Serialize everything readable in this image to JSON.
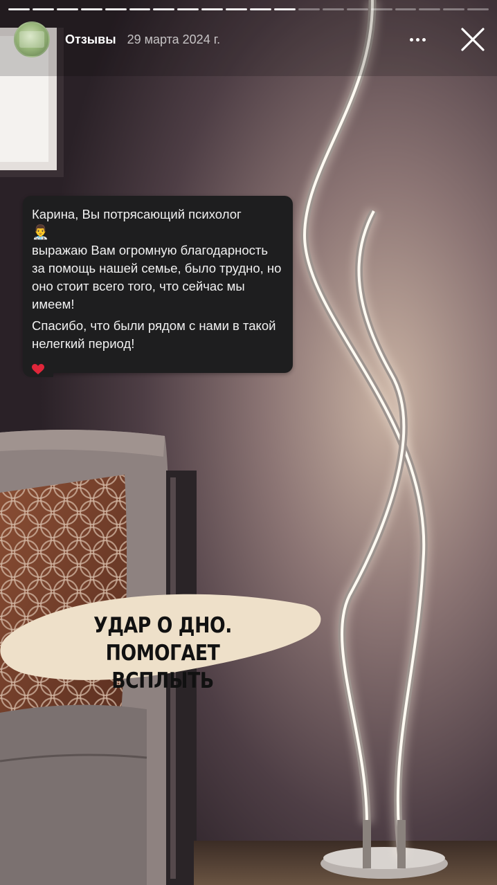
{
  "story": {
    "progress": {
      "total_segments": 20,
      "completed_segments": 12
    },
    "account_name": "Отзывы",
    "date": "29 марта 2024 г.",
    "more_icon": "more-horizontal-icon",
    "close_icon": "close-icon"
  },
  "message": {
    "line1": "Карина, Вы потрясающий психолог",
    "emoji": "👨‍⚕️",
    "body": "выражаю Вам огромную благодарность за помощь нашей семье, было трудно, но оно стоит всего того, что сейчас мы имеем!",
    "thanks": "Спасибо, что были рядом с нами в такой нелегкий период!",
    "reaction": "heart-icon"
  },
  "caption": {
    "line1": "УДАР О ДНО. ПОМОГАЕТ",
    "line2": "ВСПЛЫТЬ"
  },
  "colors": {
    "background": "#2a2226",
    "bubble": "#1e1e1f",
    "caption_bg": "#eee0c9",
    "heart": "#e0263a"
  }
}
